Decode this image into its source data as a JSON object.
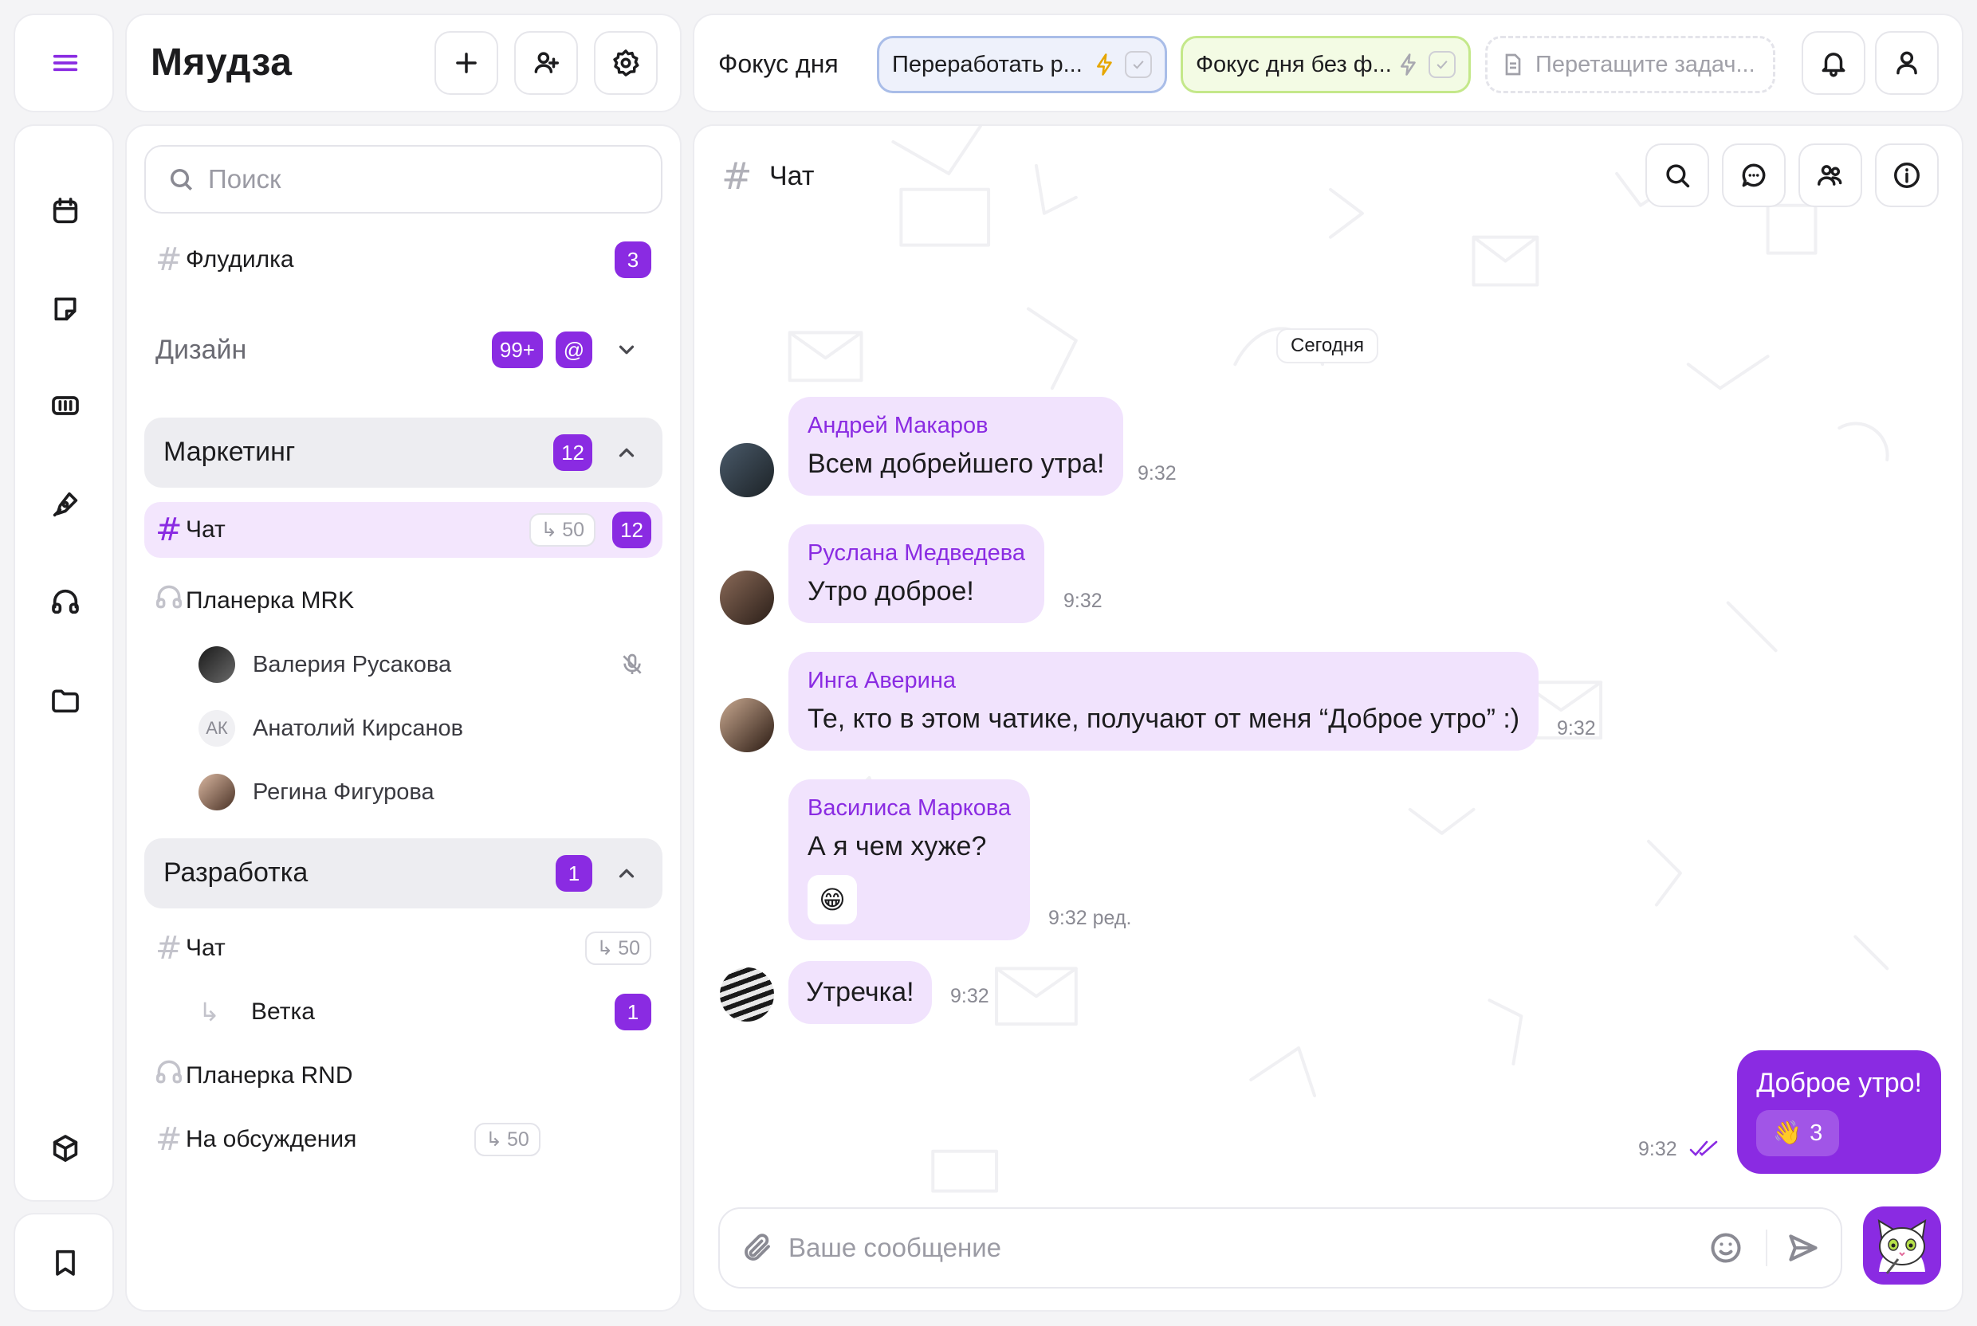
{
  "app": {
    "title": "Мяудза"
  },
  "colors": {
    "accent": "#8a2be2",
    "bubble": "#f1e3fd",
    "focus_blue": "#a9bde8",
    "focus_green": "#c4e88a"
  },
  "rail": {
    "top_icon": "menu-icon",
    "icons": [
      "calendar-icon",
      "note-icon",
      "board-icon",
      "pen-icon",
      "headphones-icon",
      "folder-icon",
      "cube-icon"
    ],
    "bottom_icon": "bookmark-icon"
  },
  "sidebar": {
    "search_placeholder": "Поиск",
    "channels": [
      {
        "name": "Флудилка",
        "badge": "3"
      }
    ],
    "groups": [
      {
        "name": "Дизайн",
        "badge": "99+",
        "mention": "@",
        "collapsed": true
      },
      {
        "name": "Маркетинг",
        "badge": "12",
        "items": [
          {
            "type": "channel",
            "name": "Чат",
            "threads": "50",
            "badge": "12",
            "active": true
          },
          {
            "type": "voice",
            "name": "Планерка MRK",
            "members": [
              {
                "name": "Валерия Русакова",
                "muted": true
              },
              {
                "name": "Анатолий Кирсанов",
                "initials": "АК"
              },
              {
                "name": "Регина Фигурова"
              }
            ]
          }
        ]
      },
      {
        "name": "Разработка",
        "badge": "1",
        "items": [
          {
            "type": "channel",
            "name": "Чат",
            "threads": "50"
          },
          {
            "type": "thread",
            "name": "Ветка",
            "badge": "1"
          },
          {
            "type": "voice",
            "name": "Планерка RND"
          },
          {
            "type": "channel",
            "name": "На обсуждения",
            "threads": "50"
          }
        ]
      }
    ]
  },
  "focus": {
    "title": "Фокус дня",
    "chips": [
      {
        "text": "Переработать р..."
      },
      {
        "text": "Фокус дня без ф..."
      },
      {
        "text": "Перетащите задач..."
      }
    ]
  },
  "chat": {
    "title": "Чат",
    "date_separator": "Сегодня",
    "messages": [
      {
        "author": "Андрей Макаров",
        "text": "Всем добрейшего утра!",
        "time": "9:32"
      },
      {
        "author": "Руслана Медведева",
        "text": "Утро доброе!",
        "time": "9:32"
      },
      {
        "author": "Инга Аверина",
        "text": "Те, кто в этом чатике, получают от меня “Доброе утро” :)",
        "time": "9:32"
      },
      {
        "author": "Василиса Маркова",
        "text": "А я чем хуже?",
        "time": "9:32 ред.",
        "reaction": "😁"
      },
      {
        "author": "",
        "text": "Утречка!",
        "time": "9:32"
      }
    ],
    "own_message": {
      "text": "Доброе утро!",
      "time": "9:32",
      "reaction_emoji": "👋",
      "reaction_count": "3"
    },
    "composer_placeholder": "Ваше сообщение"
  }
}
